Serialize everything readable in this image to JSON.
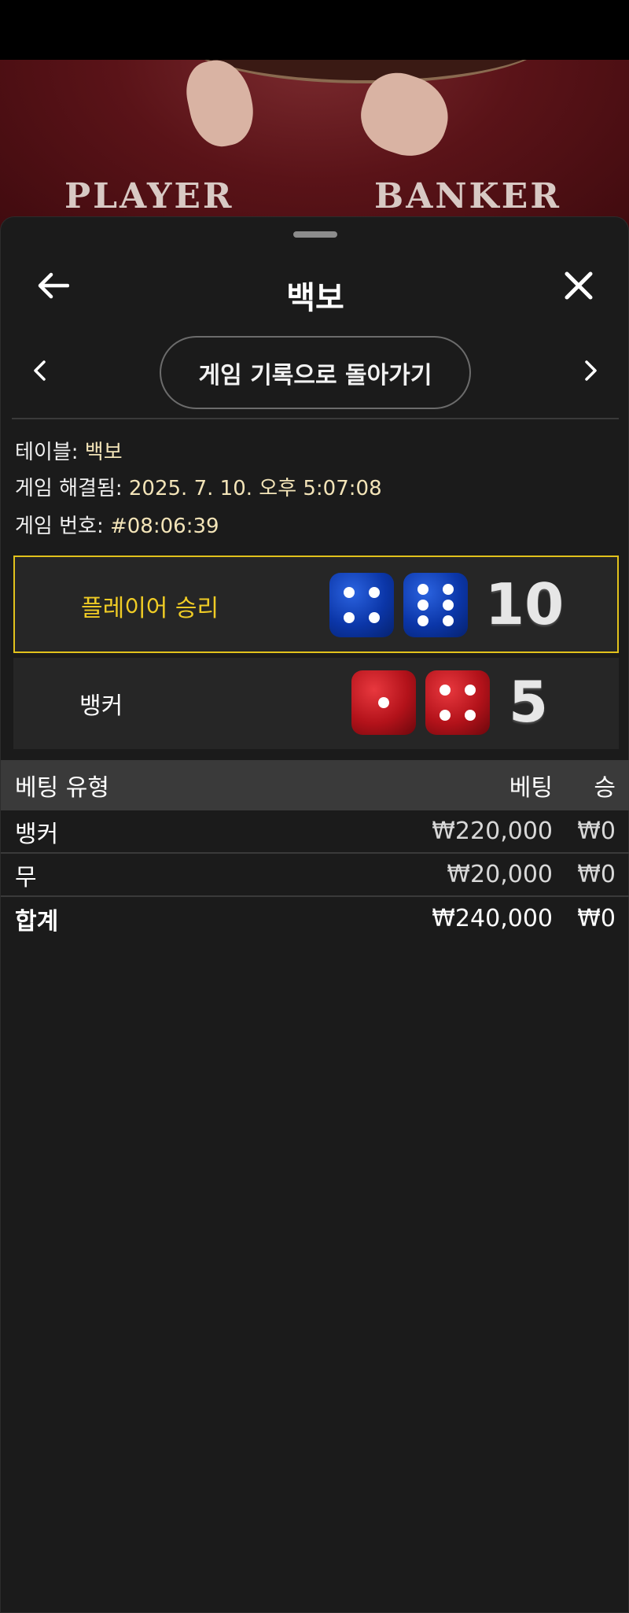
{
  "video": {
    "player_label": "PLAYER",
    "banker_label": "BANKER"
  },
  "header": {
    "title": "백보",
    "back_icon": "arrow-left-icon",
    "close_icon": "close-icon"
  },
  "nav": {
    "history_button": "게임 기록으로 돌아가기",
    "prev_icon": "chevron-left-icon",
    "next_icon": "chevron-right-icon"
  },
  "info": {
    "table_label": "테이블:",
    "table_value": "백보",
    "resolved_label": "게임 해결됨:",
    "resolved_value": "2025. 7. 10. 오후 5:07:08",
    "game_no_label": "게임 번호:",
    "game_no_value": "#08:06:39"
  },
  "results": {
    "player": {
      "label": "플레이어 승리",
      "dice": [
        4,
        6
      ],
      "score": "10",
      "color": "#f0cc25"
    },
    "banker": {
      "label": "뱅커",
      "dice": [
        1,
        4
      ],
      "score": "5"
    }
  },
  "bets": {
    "headers": {
      "type": "베팅 유형",
      "bet": "베팅",
      "win": "승"
    },
    "rows": [
      {
        "type": "뱅커",
        "bet": "₩220,000",
        "win": "₩0"
      },
      {
        "type": "무",
        "bet": "₩20,000",
        "win": "₩0"
      }
    ],
    "total": {
      "type": "합계",
      "bet": "₩240,000",
      "win": "₩0"
    }
  }
}
